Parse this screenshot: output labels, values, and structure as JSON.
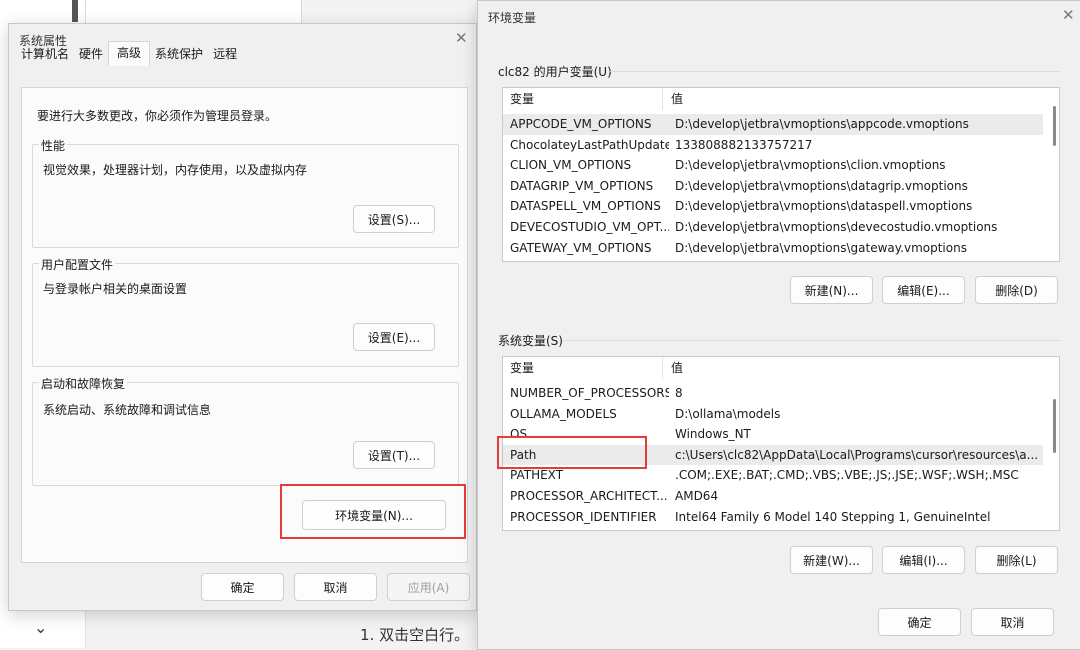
{
  "background": {
    "caption": "1. 双击空白行。",
    "chevron_icon": "chevron-down-icon"
  },
  "system_properties": {
    "title": "系统属性",
    "tabs": [
      "计算机名",
      "硬件",
      "高级",
      "系统保护",
      "远程"
    ],
    "active_tab": "高级",
    "admin_note": "要进行大多数更改，你必须作为管理员登录。",
    "performance": {
      "title": "性能",
      "desc": "视觉效果，处理器计划，内存使用，以及虚拟内存",
      "button": "设置(S)..."
    },
    "user_profile": {
      "title": "用户配置文件",
      "desc": "与登录帐户相关的桌面设置",
      "button": "设置(E)..."
    },
    "startup": {
      "title": "启动和故障恢复",
      "desc": "系统启动、系统故障和调试信息",
      "button": "设置(T)..."
    },
    "env_button": "环境变量(N)...",
    "ok": "确定",
    "cancel": "取消",
    "apply": "应用(A)",
    "highlight_color": "#e63b3b"
  },
  "env_dialog": {
    "title": "环境变量",
    "user_section": {
      "title": "clc82 的用户变量(U)",
      "col_var": "变量",
      "col_val": "值",
      "rows": [
        {
          "name": "APPCODE_VM_OPTIONS",
          "value": "D:\\develop\\jetbra\\vmoptions\\appcode.vmoptions"
        },
        {
          "name": "ChocolateyLastPathUpdate",
          "value": "133808882133757217"
        },
        {
          "name": "CLION_VM_OPTIONS",
          "value": "D:\\develop\\jetbra\\vmoptions\\clion.vmoptions"
        },
        {
          "name": "DATAGRIP_VM_OPTIONS",
          "value": "D:\\develop\\jetbra\\vmoptions\\datagrip.vmoptions"
        },
        {
          "name": "DATASPELL_VM_OPTIONS",
          "value": "D:\\develop\\jetbra\\vmoptions\\dataspell.vmoptions"
        },
        {
          "name": "DEVECOSTUDIO_VM_OPT...",
          "value": "D:\\develop\\jetbra\\vmoptions\\devecostudio.vmoptions"
        },
        {
          "name": "GATEWAY_VM_OPTIONS",
          "value": "D:\\develop\\jetbra\\vmoptions\\gateway.vmoptions"
        }
      ],
      "new": "新建(N)...",
      "edit": "编辑(E)...",
      "delete": "删除(D)"
    },
    "system_section": {
      "title": "系统变量(S)",
      "col_var": "变量",
      "col_val": "值",
      "rows": [
        {
          "name": "NUMBER_OF_PROCESSORS",
          "value": "8"
        },
        {
          "name": "OLLAMA_MODELS",
          "value": "D:\\ollama\\models"
        },
        {
          "name": "OS",
          "value": "Windows_NT"
        },
        {
          "name": "Path",
          "value": "c:\\Users\\clc82\\AppData\\Local\\Programs\\cursor\\resources\\a..."
        },
        {
          "name": "PATHEXT",
          "value": ".COM;.EXE;.BAT;.CMD;.VBS;.VBE;.JS;.JSE;.WSF;.WSH;.MSC"
        },
        {
          "name": "PROCESSOR_ARCHITECT...",
          "value": "AMD64"
        },
        {
          "name": "PROCESSOR_IDENTIFIER",
          "value": "Intel64 Family 6 Model 140 Stepping 1, GenuineIntel"
        }
      ],
      "new": "新建(W)...",
      "edit": "编辑(I)...",
      "delete": "删除(L)"
    },
    "ok": "确定",
    "cancel": "取消"
  }
}
